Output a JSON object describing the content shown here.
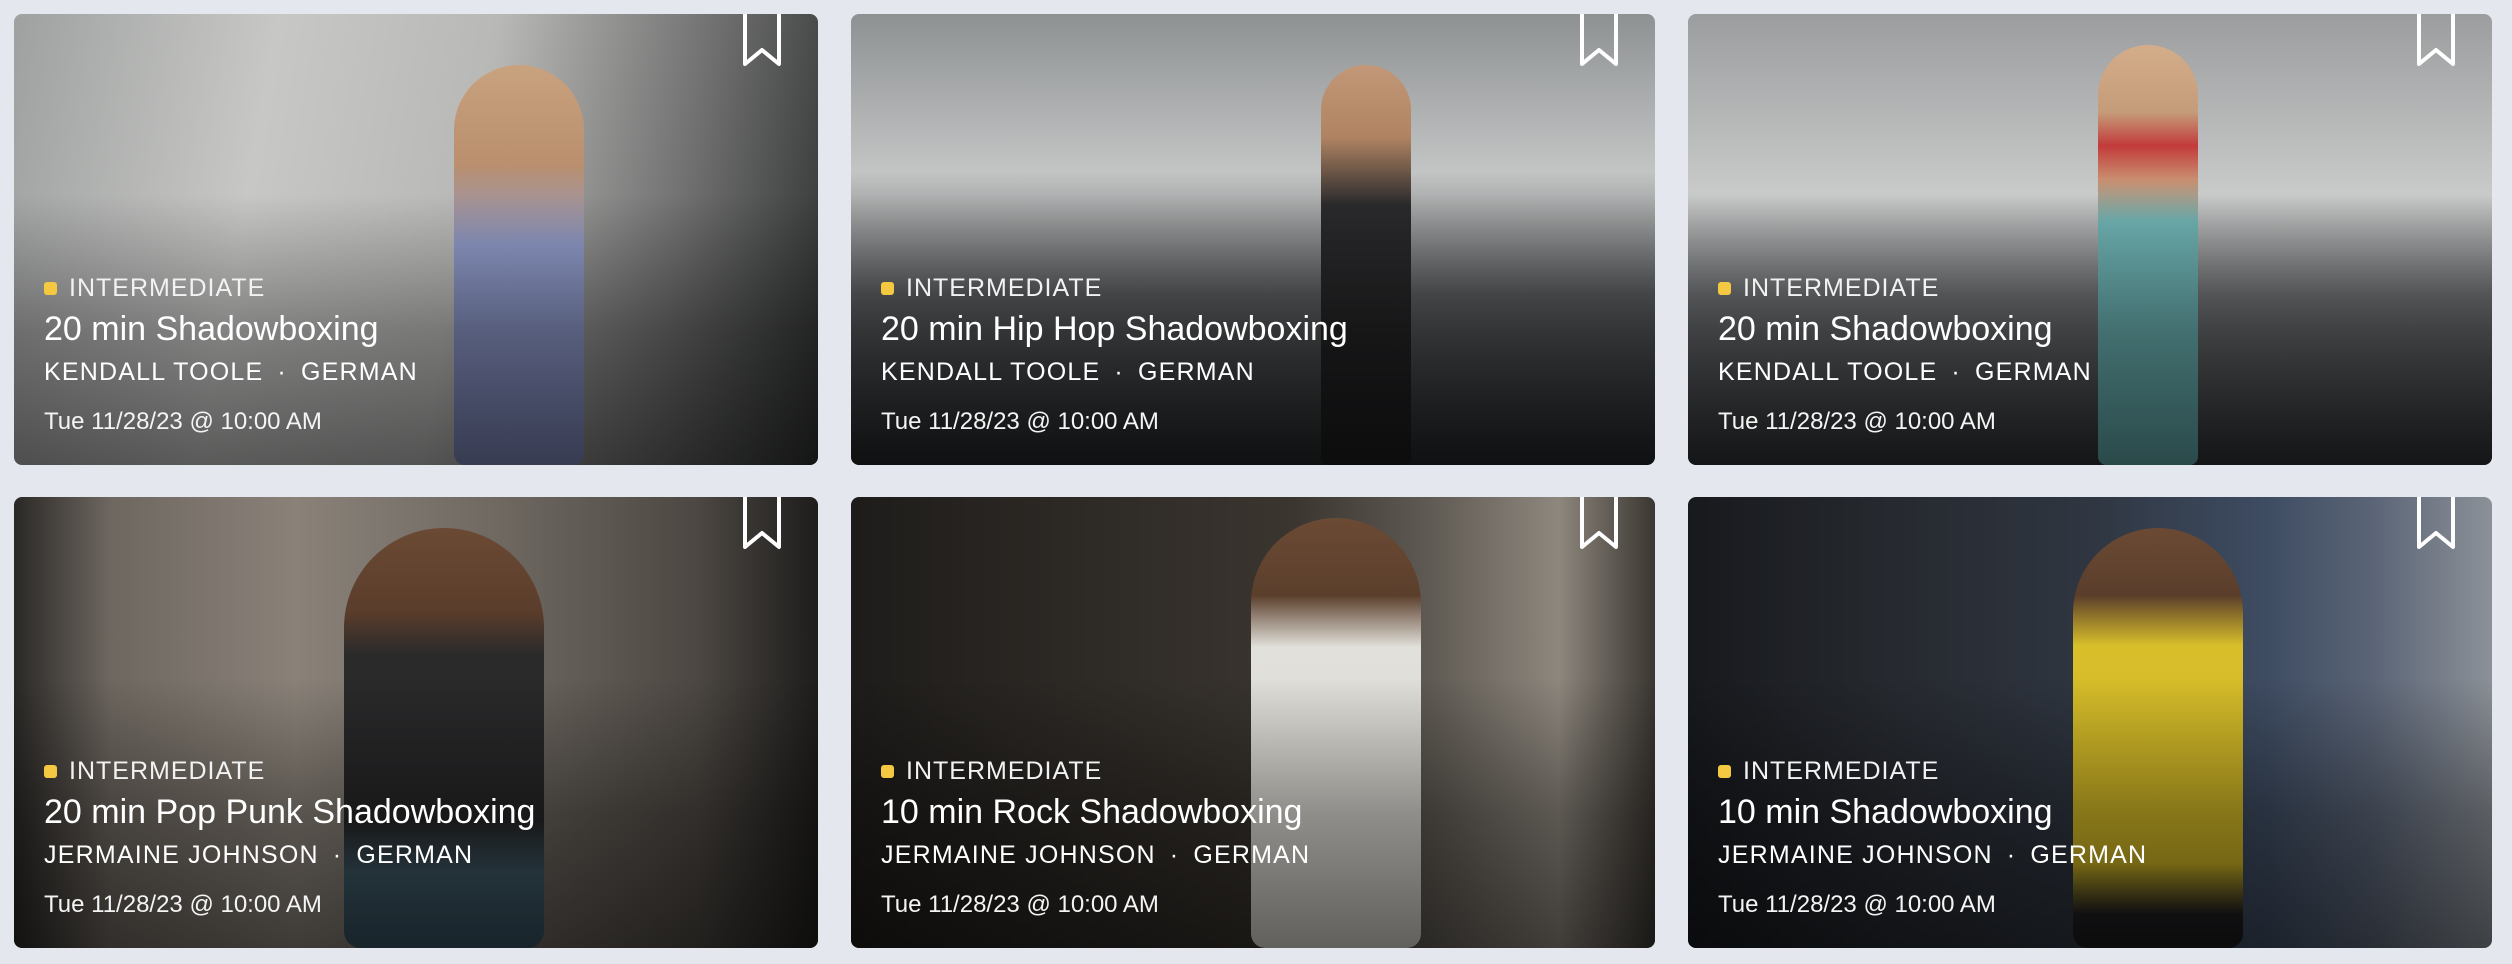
{
  "cards": [
    {
      "level": "INTERMEDIATE",
      "title": "20 min Shadowboxing",
      "instructor": "KENDALL TOOLE",
      "language": "GERMAN",
      "date": "Tue 11/28/23 @ 10:00 AM"
    },
    {
      "level": "INTERMEDIATE",
      "title": "20 min Hip Hop Shadowboxing",
      "instructor": "KENDALL TOOLE",
      "language": "GERMAN",
      "date": "Tue 11/28/23 @ 10:00 AM"
    },
    {
      "level": "INTERMEDIATE",
      "title": "20 min Shadowboxing",
      "instructor": "KENDALL TOOLE",
      "language": "GERMAN",
      "date": "Tue 11/28/23 @ 10:00 AM"
    },
    {
      "level": "INTERMEDIATE",
      "title": "20 min Pop Punk Shadowboxing",
      "instructor": "JERMAINE JOHNSON",
      "language": "GERMAN",
      "date": "Tue 11/28/23 @ 10:00 AM"
    },
    {
      "level": "INTERMEDIATE",
      "title": "10 min Rock Shadowboxing",
      "instructor": "JERMAINE JOHNSON",
      "language": "GERMAN",
      "date": "Tue 11/28/23 @ 10:00 AM"
    },
    {
      "level": "INTERMEDIATE",
      "title": "10 min Shadowboxing",
      "instructor": "JERMAINE JOHNSON",
      "language": "GERMAN",
      "date": "Tue 11/28/23 @ 10:00 AM"
    }
  ],
  "separator": "·",
  "colors": {
    "page_background": "#e4e8ee",
    "level_dot": "#f5c842"
  },
  "icons": {
    "bookmark": "bookmark-icon",
    "level": "level-dot-icon"
  }
}
